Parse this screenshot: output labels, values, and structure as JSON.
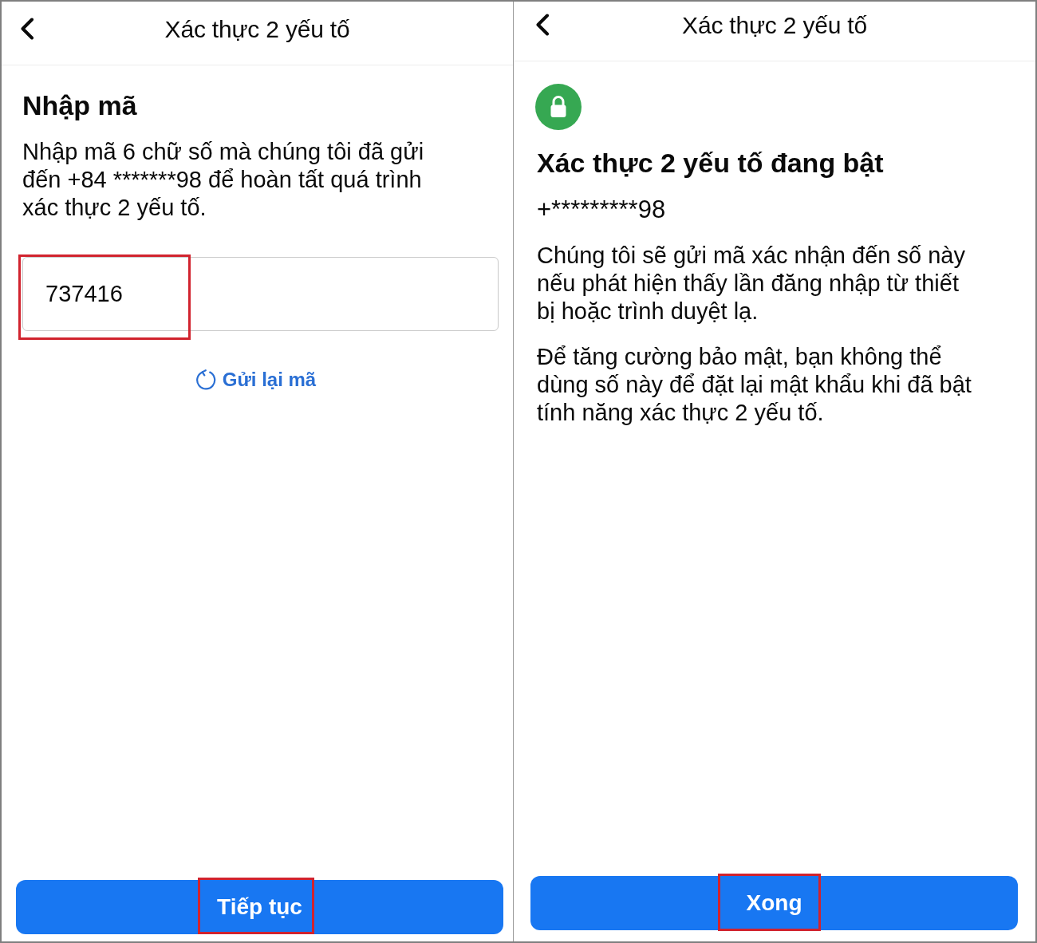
{
  "screens": [
    {
      "kind": "code_entry",
      "header": {
        "title": "Xác thực 2 yếu tố"
      },
      "heading": "Nhập mã",
      "description": "Nhập mã 6 chữ số mà chúng tôi đã gửi đến +84 *******98 để hoàn tất quá trình xác thực 2 yếu tố.",
      "code_field": {
        "value": "737416",
        "highlighted": true
      },
      "resend_link": {
        "label": "Gửi lại mã"
      },
      "primary_button": {
        "label": "Tiếp tục",
        "highlighted": true
      }
    },
    {
      "kind": "confirmation",
      "header": {
        "title": "Xác thực 2 yếu tố"
      },
      "heading": "Xác thực 2 yếu tố đang bật",
      "phone": "+*********98",
      "paragraphs": [
        "Chúng tôi sẽ gửi mã xác nhận đến số này nếu phát hiện thấy lần đăng nhập từ thiết bị hoặc trình duyệt lạ.",
        "Để tăng cường bảo mật, bạn không thể dùng số này để đặt lại mật khẩu khi đã bật tính năng xác thực 2 yếu tố."
      ],
      "primary_button": {
        "label": "Xong",
        "highlighted": true
      }
    }
  ]
}
